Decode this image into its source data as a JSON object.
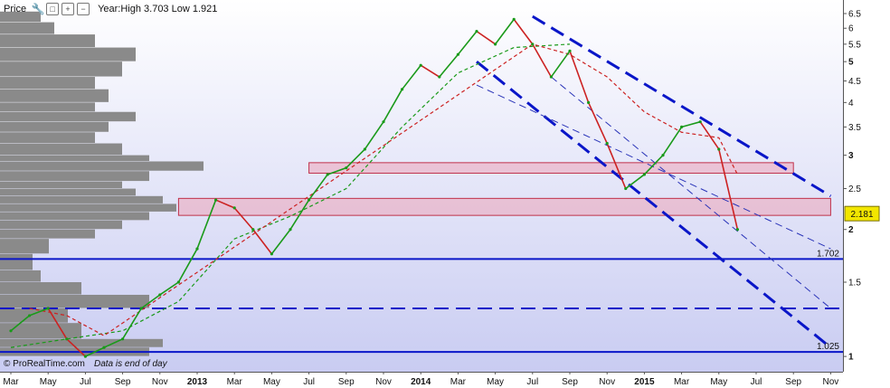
{
  "toolbar": {
    "title": "Price",
    "range_text": "Year:High 3.703 Low 1.921",
    "icons": [
      "wrench-icon",
      "window-icon",
      "add-icon",
      "remove-icon"
    ]
  },
  "footer": {
    "source": "© ProRealTime.com",
    "note": "Data is end of day"
  },
  "chart_data": {
    "type": "line",
    "title": "",
    "y_scale": "log",
    "ylim": [
      0.92,
      7.0
    ],
    "y_ticks": [
      1,
      1.5,
      2,
      2.5,
      3,
      3.5,
      4,
      4.5,
      5,
      5.5,
      6,
      6.5
    ],
    "y_tick_labels": [
      "1",
      "1.5",
      "2",
      "2.5",
      "3",
      "3.5",
      "4",
      "4.5",
      "5",
      "5.5",
      "6",
      "6.5"
    ],
    "x_ticks": [
      {
        "label": "Mar",
        "year": false
      },
      {
        "label": "May",
        "year": false
      },
      {
        "label": "Jul",
        "year": false
      },
      {
        "label": "Sep",
        "year": false
      },
      {
        "label": "Nov",
        "year": false
      },
      {
        "label": "2013",
        "year": true
      },
      {
        "label": "Mar",
        "year": false
      },
      {
        "label": "May",
        "year": false
      },
      {
        "label": "Jul",
        "year": false
      },
      {
        "label": "Sep",
        "year": false
      },
      {
        "label": "Nov",
        "year": false
      },
      {
        "label": "2014",
        "year": true
      },
      {
        "label": "Mar",
        "year": false
      },
      {
        "label": "May",
        "year": false
      },
      {
        "label": "Jul",
        "year": false
      },
      {
        "label": "Sep",
        "year": false
      },
      {
        "label": "Nov",
        "year": false
      },
      {
        "label": "2015",
        "year": true
      },
      {
        "label": "Mar",
        "year": false
      },
      {
        "label": "May",
        "year": false
      },
      {
        "label": "Jul",
        "year": false
      },
      {
        "label": "Sep",
        "year": false
      },
      {
        "label": "Nov",
        "year": false
      }
    ],
    "last_price": 2.181,
    "levels": [
      {
        "value": 1.702,
        "style": "solid",
        "label": "1.702"
      },
      {
        "value": 1.3,
        "style": "dashed",
        "label": ""
      },
      {
        "value": 1.025,
        "style": "solid",
        "label": "1.025"
      }
    ],
    "zones": [
      {
        "low": 2.72,
        "high": 2.88,
        "x_start": "2013-07",
        "x_end": "2015-09"
      },
      {
        "low": 2.16,
        "high": 2.37,
        "x_start": "2012-12",
        "x_end": "2015-11"
      }
    ],
    "trendlines": [
      {
        "from": [
          "2014-07",
          6.4
        ],
        "to": [
          "2015-11",
          2.4
        ],
        "style": "bold-dashed"
      },
      {
        "from": [
          "2014-04",
          5.0
        ],
        "to": [
          "2015-11",
          1.05
        ],
        "style": "bold-dashed"
      },
      {
        "from": [
          "2014-04",
          4.4
        ],
        "to": [
          "2015-11",
          1.8
        ],
        "style": "thin-dashed"
      },
      {
        "from": [
          "2014-08",
          4.6
        ],
        "to": [
          "2015-11",
          1.3
        ],
        "style": "thin-dashed"
      }
    ],
    "series": [
      {
        "kind": "price",
        "color": "#1a9a1a",
        "down_color": "#cc2222",
        "x": [
          "2012-03",
          "2012-04",
          "2012-05",
          "2012-06",
          "2012-07",
          "2012-08",
          "2012-09",
          "2012-10",
          "2012-11",
          "2012-12",
          "2013-01",
          "2013-02",
          "2013-03",
          "2013-04",
          "2013-05",
          "2013-06",
          "2013-07",
          "2013-08",
          "2013-09",
          "2013-10",
          "2013-11",
          "2013-12",
          "2014-01",
          "2014-02",
          "2014-03",
          "2014-04",
          "2014-05",
          "2014-06",
          "2014-07",
          "2014-08",
          "2014-09",
          "2014-10",
          "2014-11",
          "2014-12",
          "2015-01",
          "2015-02",
          "2015-03",
          "2015-04",
          "2015-05",
          "2015-06"
        ],
        "y": [
          1.15,
          1.25,
          1.3,
          1.1,
          1.0,
          1.05,
          1.1,
          1.3,
          1.4,
          1.5,
          1.8,
          2.35,
          2.25,
          2.0,
          1.75,
          2.0,
          2.35,
          2.7,
          2.8,
          3.1,
          3.6,
          4.3,
          4.9,
          4.6,
          5.2,
          5.9,
          5.5,
          6.3,
          5.5,
          4.6,
          5.3,
          4.0,
          3.2,
          2.5,
          2.7,
          3.0,
          3.5,
          3.6,
          3.1,
          2.0
        ]
      },
      {
        "kind": "moving-average",
        "color": "#1a9a1a",
        "x": [
          "2012-03",
          "2012-06",
          "2012-09",
          "2012-12",
          "2013-03",
          "2013-06",
          "2013-09",
          "2013-12",
          "2014-03",
          "2014-06",
          "2014-09"
        ],
        "y": [
          1.05,
          1.1,
          1.15,
          1.35,
          1.9,
          2.15,
          2.5,
          3.5,
          4.7,
          5.4,
          5.5
        ]
      },
      {
        "kind": "moving-average",
        "color": "#cc2222",
        "x": [
          "2012-04",
          "2012-06",
          "2012-08",
          "2014-07",
          "2014-09",
          "2014-11",
          "2015-01",
          "2015-03",
          "2015-05",
          "2015-06"
        ],
        "y": [
          1.3,
          1.25,
          1.12,
          5.5,
          5.2,
          4.6,
          3.8,
          3.4,
          3.3,
          2.7
        ]
      }
    ],
    "volume_profile": {
      "color": "#8a8a8a",
      "price_bins": [
        1.0,
        1.05,
        1.1,
        1.2,
        1.3,
        1.4,
        1.5,
        1.6,
        1.75,
        1.9,
        2.0,
        2.1,
        2.2,
        2.3,
        2.4,
        2.5,
        2.6,
        2.75,
        2.9,
        3.0,
        3.2,
        3.4,
        3.6,
        3.8,
        4.0,
        4.3,
        4.6,
        5.0,
        5.4,
        5.8,
        6.2
      ],
      "volumes": [
        0.55,
        0.6,
        0.3,
        0.25,
        0.55,
        0.3,
        0.15,
        0.12,
        0.18,
        0.35,
        0.45,
        0.55,
        0.65,
        0.6,
        0.5,
        0.45,
        0.55,
        0.75,
        0.55,
        0.45,
        0.35,
        0.4,
        0.5,
        0.35,
        0.4,
        0.35,
        0.45,
        0.5,
        0.35,
        0.2,
        0.15
      ]
    }
  }
}
